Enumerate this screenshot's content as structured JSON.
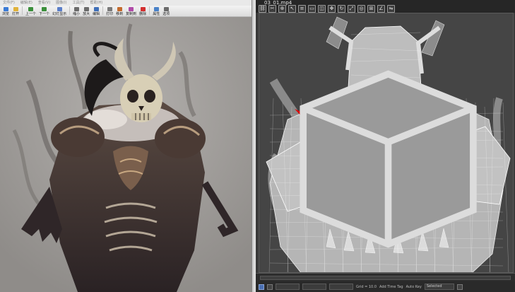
{
  "viewer": {
    "menubar": [
      "文件(F)",
      "编辑(E)",
      "查看(V)",
      "图像(I)",
      "工具(T)",
      "帮助(H)"
    ],
    "toolbar": [
      {
        "label": "浏览",
        "icon": "browse-icon",
        "color": "#3b7bd6"
      },
      {
        "label": "打开",
        "icon": "open-folder-icon",
        "color": "#e0b23a"
      },
      {
        "label": "上一个",
        "icon": "previous-icon",
        "color": "#3b8f3b"
      },
      {
        "label": "下一个",
        "icon": "next-icon",
        "color": "#3b8f3b"
      },
      {
        "label": "幻灯显示",
        "icon": "slideshow-icon",
        "color": "#5a7ec9"
      },
      {
        "label": "缩小",
        "icon": "zoom-out-icon",
        "color": "#6b6b6b"
      },
      {
        "label": "放大",
        "icon": "zoom-in-icon",
        "color": "#6b6b6b"
      },
      {
        "label": "编辑",
        "icon": "edit-icon",
        "color": "#3f6fb8"
      },
      {
        "label": "打印",
        "icon": "print-icon",
        "color": "#7a7a7a"
      },
      {
        "label": "移到",
        "icon": "move-to-icon",
        "color": "#c46a2c"
      },
      {
        "label": "复制到",
        "icon": "copy-to-icon",
        "color": "#b04aa8"
      },
      {
        "label": "删除",
        "icon": "delete-icon",
        "color": "#d32f2f"
      },
      {
        "label": "属性",
        "icon": "properties-icon",
        "color": "#4a82c8"
      },
      {
        "label": "选项",
        "icon": "options-icon",
        "color": "#6a6a6a"
      }
    ]
  },
  "max": {
    "title": "03_01.mp4",
    "toolbar_icons": [
      "link-icon",
      "unlink-icon",
      "bind-icon",
      "select-icon",
      "select-by-name-icon",
      "rect-select-icon",
      "window-crossing-icon",
      "move-icon",
      "rotate-icon",
      "scale-icon",
      "reference-icon",
      "snap-icon",
      "angle-snap-icon",
      "mirror-icon"
    ],
    "status": {
      "grid_label": "Grid = 10.0",
      "add_time_tag": "Add Time Tag",
      "auto_key": "Auto Key",
      "selected": "Selected"
    }
  }
}
